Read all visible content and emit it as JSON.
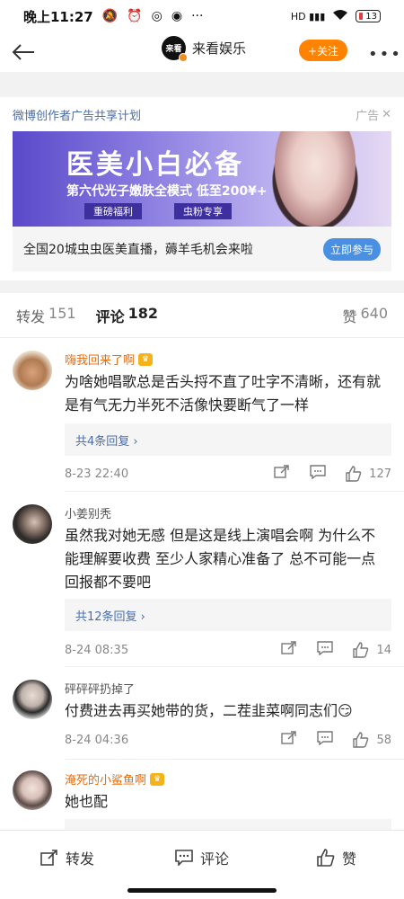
{
  "status_bar": {
    "time": "晚上11:27",
    "battery": "13"
  },
  "header": {
    "account_name": "来看娱乐",
    "logo_text": "来看",
    "follow_label": "+关注"
  },
  "ad": {
    "program_label": "微博创作者广告共享计划",
    "ad_tag": "广告",
    "banner_title": "医美小白必备",
    "banner_subtitle": "第六代光子嫩肤全模式 低至200¥+",
    "banner_pill_1": "重磅福利",
    "banner_pill_2": "虫粉专享",
    "headline": "全国20城虫虫医美直播，薅羊毛机会来啦",
    "cta": "立即参与"
  },
  "tabs": [
    {
      "label": "转发",
      "count": "151"
    },
    {
      "label": "评论",
      "count": "182"
    },
    {
      "label": "赞",
      "count": "640"
    }
  ],
  "comments": [
    {
      "user": "嗨我回来了啊",
      "text": "为啥她唱歌总是舌头捋不直了吐字不清晰，还有就是有气无力半死不活像快要断气了一样",
      "replies": "共4条回复 ›",
      "time": "8-23 22:40",
      "likes": "127"
    },
    {
      "user": "小姜别秃",
      "text": "虽然我对她无感 但是这是线上演唱会啊 为什么不能理解要收费 至少人家精心准备了 总不可能一点回报都不要吧",
      "replies": "共12条回复 ›",
      "time": "8-24 08:35",
      "likes": "14"
    },
    {
      "user": "砰砰砰扔掉了",
      "text": "付费进去再买她带的货，二茬韭菜啊同志们😏",
      "time": "8-24 04:36",
      "likes": "58"
    },
    {
      "user": "淹死的小鲨鱼啊",
      "text": "她也配"
    }
  ],
  "bottom_bar": {
    "repost": "转发",
    "comment": "评论",
    "like": "赞"
  }
}
